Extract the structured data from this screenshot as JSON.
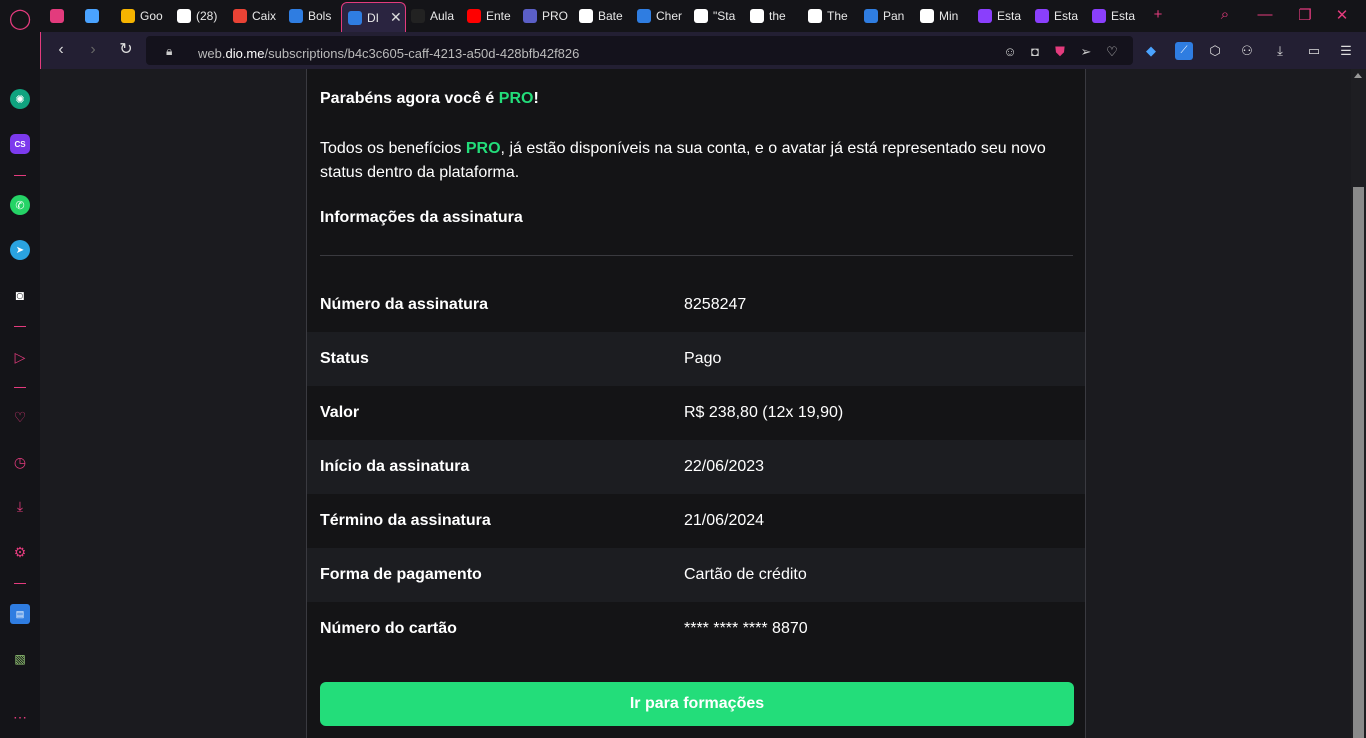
{
  "tabs": [
    {
      "label": "",
      "icon": "gamepad-icon",
      "color": "#e33b7d"
    },
    {
      "label": "",
      "icon": "diamond-icon",
      "color": "#4aa3ff"
    },
    {
      "label": "Goo",
      "icon": "keep-icon",
      "color": "#f6b400"
    },
    {
      "label": "(28)",
      "icon": "w-icon",
      "color": "#ffffff"
    },
    {
      "label": "Caix",
      "icon": "gmail-icon",
      "color": "#ea4335"
    },
    {
      "label": "Bols",
      "icon": "edge-icon",
      "color": "#2f7de1"
    },
    {
      "label": "DI",
      "icon": "dio-icon",
      "color": "#2f7de1"
    },
    {
      "label": "Aula",
      "icon": "a-icon",
      "color": "#222222"
    },
    {
      "label": "Ente",
      "icon": "youtube-icon",
      "color": "#ff0000"
    },
    {
      "label": "PRO",
      "icon": "teams-icon",
      "color": "#5b5fc7"
    },
    {
      "label": "Bate",
      "icon": "globe-icon",
      "color": "#ffffff"
    },
    {
      "label": "Cher",
      "icon": "edge-icon",
      "color": "#2f7de1"
    },
    {
      "label": "\"Sta",
      "icon": "os-icon",
      "color": "#ffffff"
    },
    {
      "label": "the",
      "icon": "google-icon",
      "color": "#ffffff"
    },
    {
      "label": "The",
      "icon": "os-icon",
      "color": "#ffffff"
    },
    {
      "label": "Pan",
      "icon": "check-icon",
      "color": "#2f7de1"
    },
    {
      "label": "Min",
      "icon": "google-icon",
      "color": "#ffffff"
    },
    {
      "label": "Esta",
      "icon": "u-icon",
      "color": "#8a3ffc"
    },
    {
      "label": "Esta",
      "icon": "u-icon",
      "color": "#8a3ffc"
    },
    {
      "label": "Esta",
      "icon": "u-icon",
      "color": "#8a3ffc"
    }
  ],
  "address": {
    "url_prefix": "web.",
    "url_domain": "dio.me",
    "url_path": "/subscriptions/b4c3c605-caff-4213-a50d-428bfb42f826"
  },
  "content": {
    "congrats_prefix": "Parabéns agora você é ",
    "congrats_pro": "PRO",
    "congrats_suffix": "!",
    "desc_prefix": "Todos os benefícios ",
    "desc_pro": "PRO",
    "desc_suffix": ", já estão disponíveis na sua conta, e o avatar já está representado seu novo status dentro da plataforma.",
    "info_title": "Informações da assinatura",
    "rows": [
      {
        "label": "Número da assinatura",
        "value": "8258247"
      },
      {
        "label": "Status",
        "value": "Pago"
      },
      {
        "label": "Valor",
        "value": "R$ 238,80 (12x 19,90)"
      },
      {
        "label": "Início da assinatura",
        "value": "22/06/2023"
      },
      {
        "label": "Término da assinatura",
        "value": "21/06/2024"
      },
      {
        "label": "Forma de pagamento",
        "value": "Cartão de crédito"
      },
      {
        "label": "Número do cartão",
        "value": "**** **** **** 8870"
      }
    ],
    "cta_label": "Ir para formações"
  },
  "colors": {
    "accent": "#e33b7d",
    "pro_green": "#23dd7a"
  }
}
